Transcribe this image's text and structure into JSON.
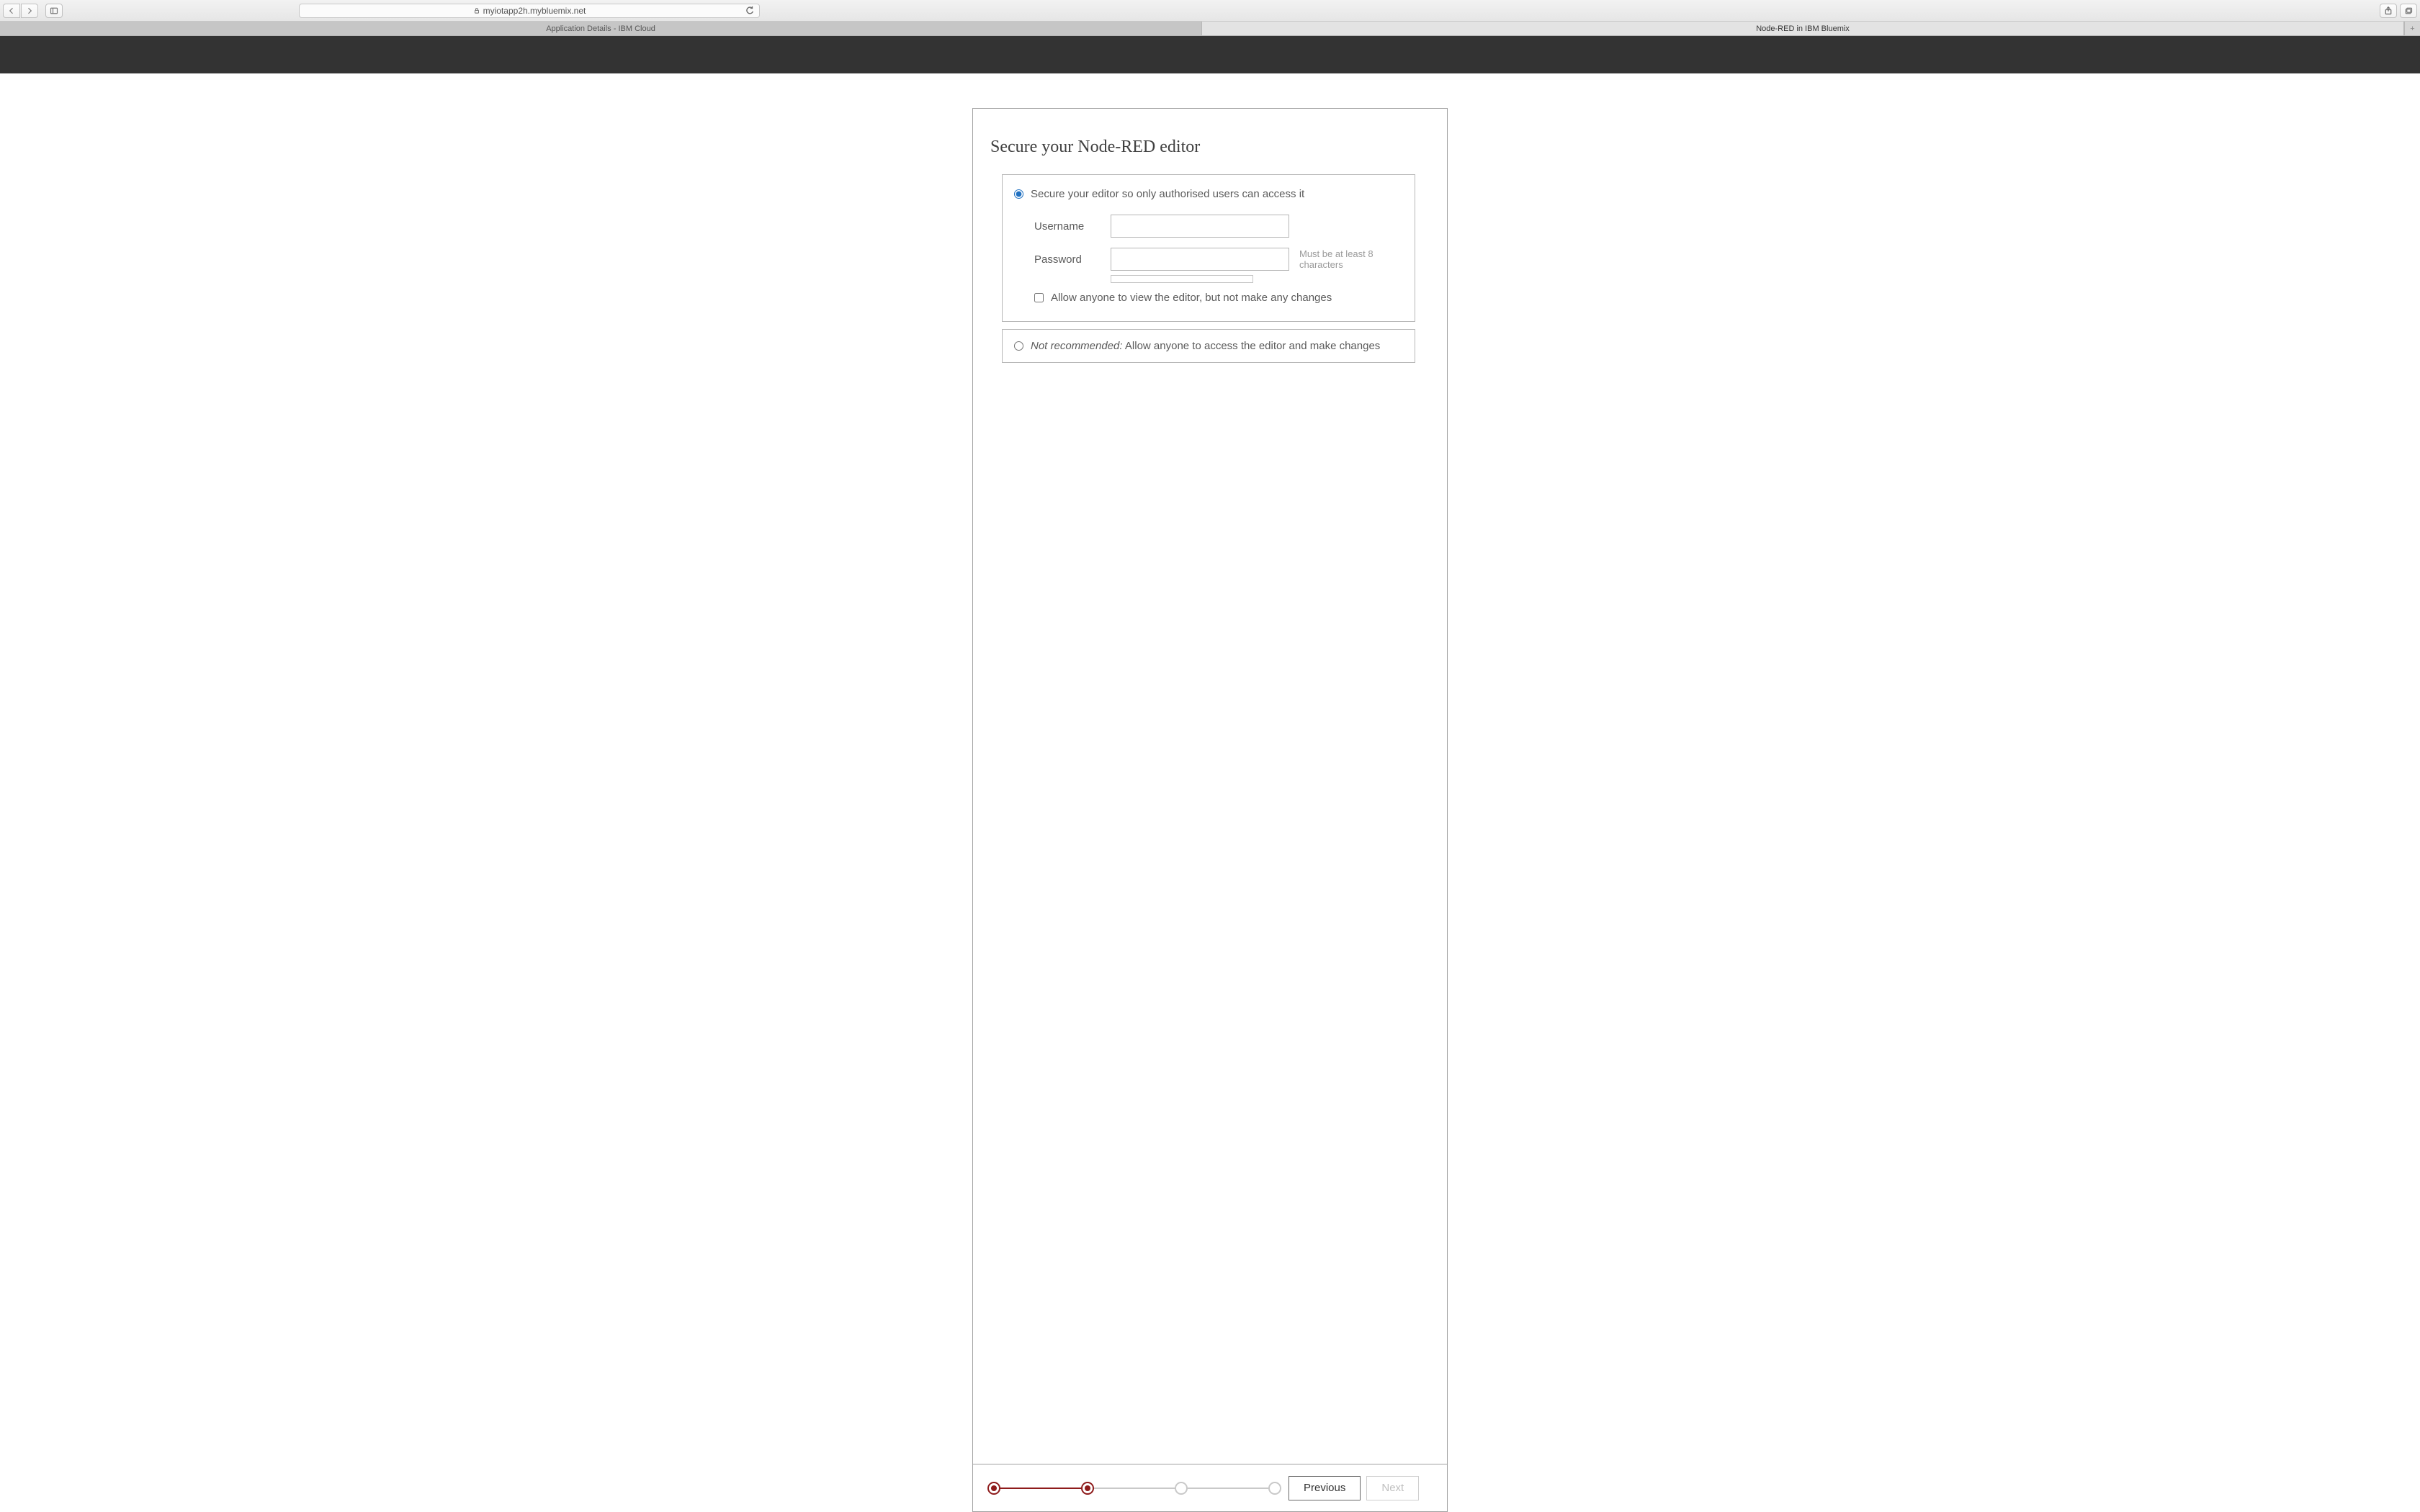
{
  "browser": {
    "url_host": "myiotapp2h.mybluemix.net",
    "tabs": [
      {
        "label": "Application Details - IBM Cloud",
        "active": false
      },
      {
        "label": "Node-RED in IBM Bluemix",
        "active": true
      }
    ]
  },
  "wizard": {
    "title": "Secure your Node-RED editor",
    "option_secure": {
      "label": "Secure your editor so only authorised users can access it",
      "selected": true,
      "username_label": "Username",
      "username_value": "",
      "password_label": "Password",
      "password_value": "",
      "password_hint": "Must be at least 8 characters",
      "allow_readonly_label": "Allow anyone to view the editor, but not make any changes",
      "allow_readonly_checked": false
    },
    "option_open": {
      "prefix": "Not recommended:",
      "label": " Allow anyone to access the editor and make changes",
      "selected": false
    },
    "steps": {
      "total": 4,
      "current": 2
    },
    "buttons": {
      "previous": "Previous",
      "next": "Next",
      "next_enabled": false
    }
  }
}
